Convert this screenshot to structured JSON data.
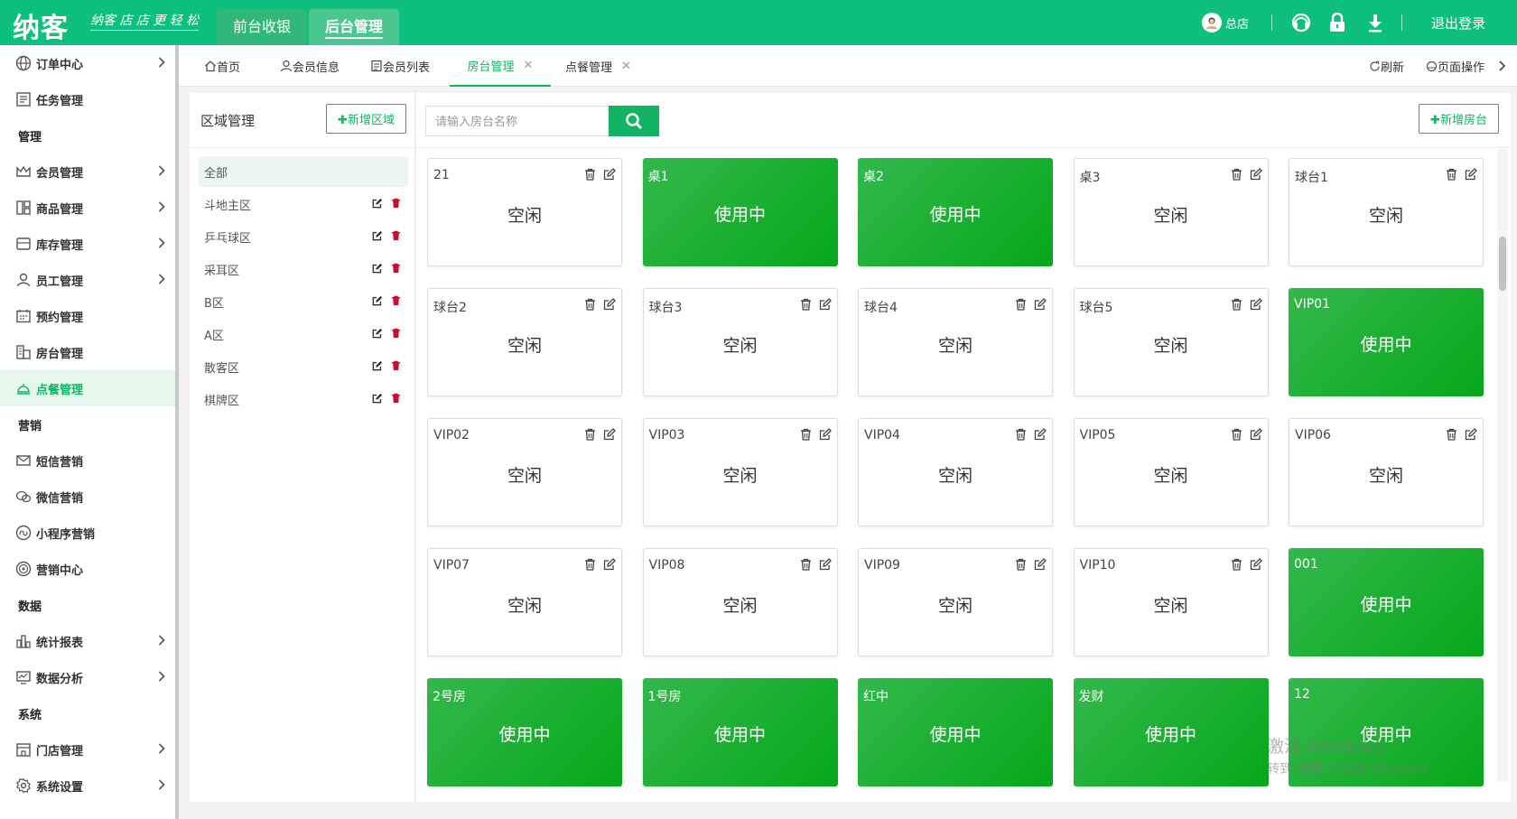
{
  "colors": {
    "brand": "#0fbf7e",
    "accent": "#12b363",
    "busy": "#1db43a"
  },
  "header": {
    "logo": "纳客",
    "slogan": "纳客 店 店 更 轻 松",
    "tabs": [
      {
        "label": "前台收银"
      },
      {
        "label": "后台管理"
      }
    ],
    "store": "总店",
    "logout": "退出登录",
    "icons": [
      "user-avatar-icon",
      "headset-icon",
      "lock-icon",
      "download-icon"
    ]
  },
  "sidebar": {
    "items": [
      {
        "label": "订单中心",
        "icon": "globe-icon",
        "chev": true
      },
      {
        "label": "任务管理",
        "icon": "task-icon",
        "chev": false
      },
      {
        "group": "管理"
      },
      {
        "label": "会员管理",
        "icon": "crown-icon",
        "chev": true
      },
      {
        "label": "商品管理",
        "icon": "goods-icon",
        "chev": true
      },
      {
        "label": "库存管理",
        "icon": "inventory-icon",
        "chev": true
      },
      {
        "label": "员工管理",
        "icon": "person-icon",
        "chev": true
      },
      {
        "label": "预约管理",
        "icon": "calendar-icon",
        "chev": false
      },
      {
        "label": "房台管理",
        "icon": "building-icon",
        "chev": false
      },
      {
        "label": "点餐管理",
        "icon": "bell-icon",
        "chev": false,
        "active": true
      },
      {
        "group": "营销"
      },
      {
        "label": "短信营销",
        "icon": "mail-icon",
        "chev": false
      },
      {
        "label": "微信营销",
        "icon": "wechat-icon",
        "chev": false
      },
      {
        "label": "小程序营销",
        "icon": "miniapp-icon",
        "chev": false
      },
      {
        "label": "营销中心",
        "icon": "target-icon",
        "chev": false
      },
      {
        "group": "数据"
      },
      {
        "label": "统计报表",
        "icon": "bar-chart-icon",
        "chev": true
      },
      {
        "label": "数据分析",
        "icon": "monitor-chart-icon",
        "chev": true
      },
      {
        "group": "系统"
      },
      {
        "label": "门店管理",
        "icon": "store-icon",
        "chev": true
      },
      {
        "label": "系统设置",
        "icon": "gear-icon",
        "chev": true
      }
    ]
  },
  "tabbar": {
    "tabs": [
      {
        "label": "首页",
        "icon": "home-icon",
        "closable": false
      },
      {
        "label": "会员信息",
        "icon": "user-icon",
        "closable": false
      },
      {
        "label": "会员列表",
        "icon": "list-icon",
        "closable": false
      },
      {
        "label": "房台管理",
        "closable": true,
        "active": true
      },
      {
        "label": "点餐管理",
        "closable": true
      }
    ],
    "refresh": "刷新",
    "page_ops": "页面操作"
  },
  "region": {
    "title": "区域管理",
    "add_label": "✚新增区域",
    "items": [
      {
        "label": "全部",
        "active": true
      },
      {
        "label": "斗地主区"
      },
      {
        "label": "乒乓球区"
      },
      {
        "label": "采耳区"
      },
      {
        "label": "B区"
      },
      {
        "label": "A区"
      },
      {
        "label": "散客区"
      },
      {
        "label": "棋牌区"
      }
    ]
  },
  "main": {
    "search_placeholder": "请输入房台名称",
    "add_label": "✚新增房台",
    "tables": [
      {
        "name": "21",
        "status": "空闲",
        "busy": false
      },
      {
        "name": "桌1",
        "status": "使用中",
        "busy": true
      },
      {
        "name": "桌2",
        "status": "使用中",
        "busy": true
      },
      {
        "name": "桌3",
        "status": "空闲",
        "busy": false
      },
      {
        "name": "球台1",
        "status": "空闲",
        "busy": false
      },
      {
        "name": "球台2",
        "status": "空闲",
        "busy": false
      },
      {
        "name": "球台3",
        "status": "空闲",
        "busy": false
      },
      {
        "name": "球台4",
        "status": "空闲",
        "busy": false
      },
      {
        "name": "球台5",
        "status": "空闲",
        "busy": false
      },
      {
        "name": "VIP01",
        "status": "使用中",
        "busy": true
      },
      {
        "name": "VIP02",
        "status": "空闲",
        "busy": false
      },
      {
        "name": "VIP03",
        "status": "空闲",
        "busy": false
      },
      {
        "name": "VIP04",
        "status": "空闲",
        "busy": false
      },
      {
        "name": "VIP05",
        "status": "空闲",
        "busy": false
      },
      {
        "name": "VIP06",
        "status": "空闲",
        "busy": false
      },
      {
        "name": "VIP07",
        "status": "空闲",
        "busy": false
      },
      {
        "name": "VIP08",
        "status": "空闲",
        "busy": false
      },
      {
        "name": "VIP09",
        "status": "空闲",
        "busy": false
      },
      {
        "name": "VIP10",
        "status": "空闲",
        "busy": false
      },
      {
        "name": "001",
        "status": "使用中",
        "busy": true
      },
      {
        "name": "2号房",
        "status": "使用中",
        "busy": true
      },
      {
        "name": "1号房",
        "status": "使用中",
        "busy": true
      },
      {
        "name": "红中",
        "status": "使用中",
        "busy": true
      },
      {
        "name": "发财",
        "status": "使用中",
        "busy": true
      },
      {
        "name": "12",
        "status": "使用中",
        "busy": true
      }
    ]
  },
  "watermark": {
    "line1": "激活 Windows",
    "line2": "转到\"设置\"以激活 Windows。"
  }
}
